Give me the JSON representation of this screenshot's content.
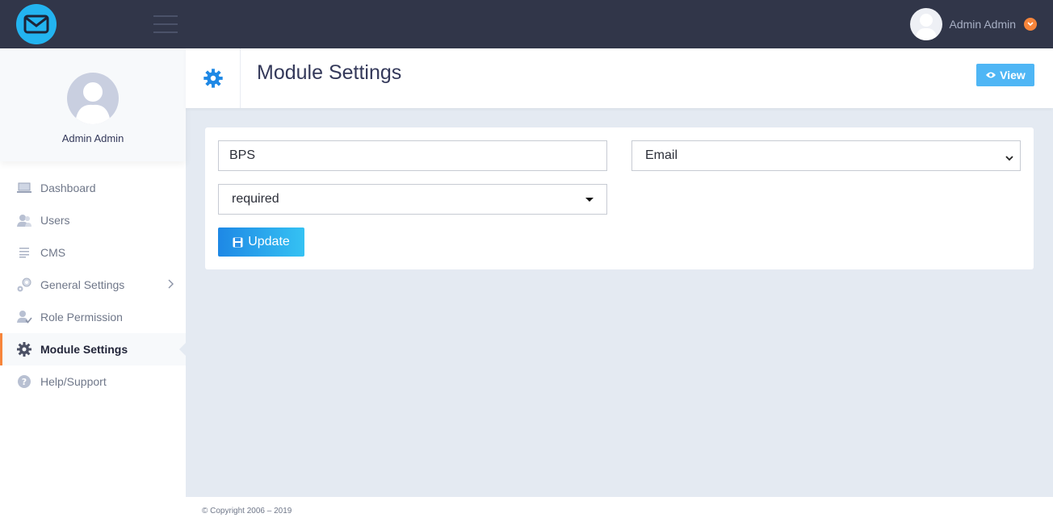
{
  "topbar": {
    "user_name": "Admin Admin"
  },
  "sidebar": {
    "profile_name": "Admin Admin",
    "items": [
      {
        "label": "Dashboard",
        "icon": "laptop-icon"
      },
      {
        "label": "Users",
        "icon": "users-icon"
      },
      {
        "label": "CMS",
        "icon": "text-lines-icon"
      },
      {
        "label": "General Settings",
        "icon": "gears-icon"
      },
      {
        "label": "Role Permission",
        "icon": "user-check-icon"
      },
      {
        "label": "Module Settings",
        "icon": "gear-icon",
        "active": true
      },
      {
        "label": "Help/Support",
        "icon": "question-icon"
      }
    ]
  },
  "header": {
    "title": "Module Settings",
    "view_label": "View"
  },
  "form": {
    "name_value": "BPS",
    "type_value": "Email",
    "required_value": "required",
    "update_label": "Update"
  },
  "footer": {
    "copyright": "© Copyright 2006 – 2019"
  },
  "colors": {
    "topbar": "#313649",
    "accent_orange": "#f7853b",
    "primary_blue": "#1e88e5",
    "logo_blue": "#23b4f0"
  }
}
